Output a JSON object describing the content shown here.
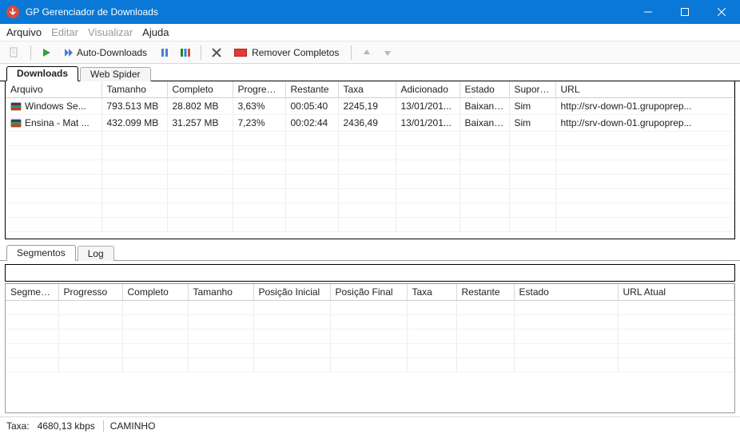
{
  "titlebar": {
    "title": "GP Gerenciador de Downloads"
  },
  "menu": {
    "arquivo": "Arquivo",
    "editar": "Editar",
    "visualizar": "Visualizar",
    "ajuda": "Ajuda"
  },
  "toolbar": {
    "auto_downloads": "Auto-Downloads",
    "remover_completos": "Remover Completos"
  },
  "top_tabs": {
    "downloads": "Downloads",
    "web_spider": "Web Spider"
  },
  "columns_main": {
    "arquivo": "Arquivo",
    "tamanho": "Tamanho",
    "completo": "Completo",
    "progresso": "Progresso",
    "restante": "Restante",
    "taxa": "Taxa",
    "adicionado": "Adicionado",
    "estado": "Estado",
    "suporta": "Suport...",
    "url": "URL"
  },
  "rows": [
    {
      "arquivo": "Windows Se...",
      "tamanho": "793.513 MB",
      "completo": "28.802 MB",
      "progresso": "3,63%",
      "restante": "00:05:40",
      "taxa": "2245,19",
      "adicionado": "13/01/201...",
      "estado": "Baixando",
      "suporta": "Sim",
      "url": "http://srv-down-01.grupoprep..."
    },
    {
      "arquivo": "Ensina - Mat ...",
      "tamanho": "432.099 MB",
      "completo": "31.257 MB",
      "progresso": "7,23%",
      "restante": "00:02:44",
      "taxa": "2436,49",
      "adicionado": "13/01/201...",
      "estado": "Baixando",
      "suporta": "Sim",
      "url": "http://srv-down-01.grupoprep..."
    }
  ],
  "bottom_tabs": {
    "segmentos": "Segmentos",
    "log": "Log"
  },
  "columns_seg": {
    "segmento": "Segmento",
    "progresso": "Progresso",
    "completo": "Completo",
    "tamanho": "Tamanho",
    "pos_ini": "Posição Inicial",
    "pos_fim": "Posição Final",
    "taxa": "Taxa",
    "restante": "Restante",
    "estado": "Estado",
    "url_atual": "URL Atual"
  },
  "status": {
    "taxa_label": "Taxa:",
    "taxa_value": "4680,13 kbps",
    "caminho": "CAMINHO"
  }
}
